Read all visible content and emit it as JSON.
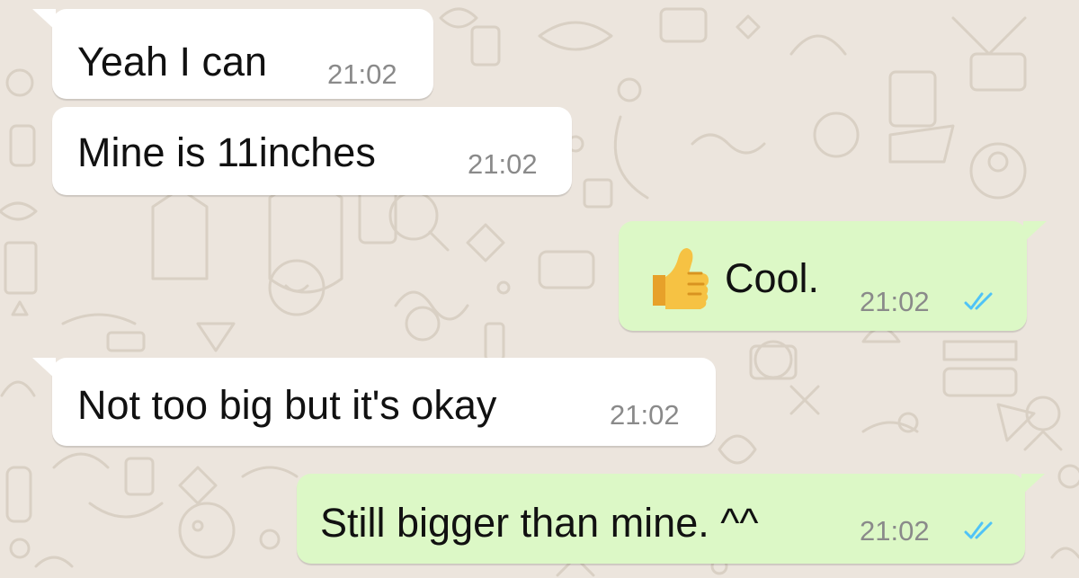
{
  "chat": {
    "messages": [
      {
        "direction": "incoming",
        "text": "Yeah I can",
        "time": "21:02"
      },
      {
        "direction": "incoming",
        "text": "Mine is 11inches",
        "time": "21:02"
      },
      {
        "direction": "outgoing",
        "emoji": "thumbs-up-emoji",
        "text": "Cool.",
        "time": "21:02",
        "status": "read-double-check-icon"
      },
      {
        "direction": "incoming",
        "text": "Not too big but it's okay",
        "time": "21:02"
      },
      {
        "direction": "outgoing",
        "text": "Still bigger than mine. ^^",
        "time": "21:02",
        "status": "read-double-check-icon"
      }
    ]
  },
  "colors": {
    "background": "#ece5dd",
    "incoming_bubble": "#ffffff",
    "outgoing_bubble": "#dcf8c6",
    "timestamp": "#8a8a8a",
    "read_ticks": "#4fc3f7"
  }
}
